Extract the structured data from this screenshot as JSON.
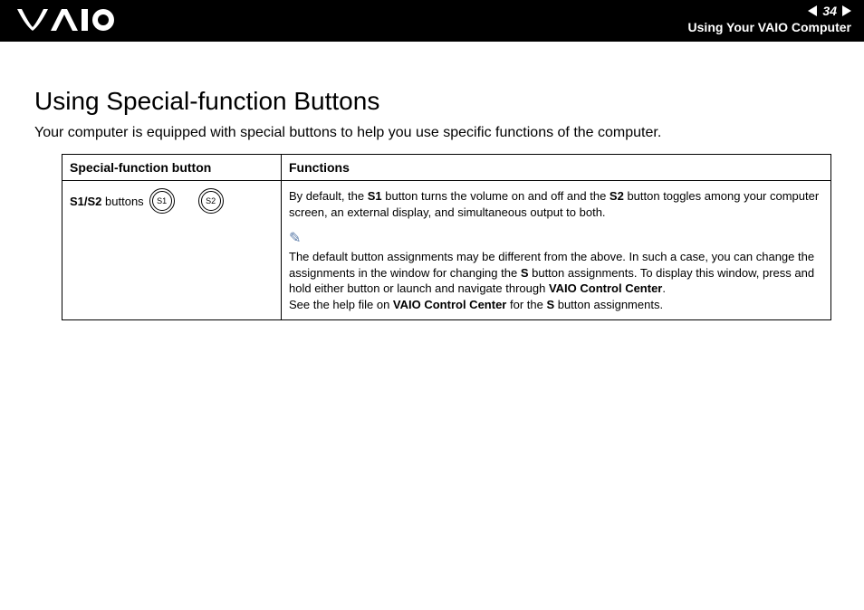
{
  "header": {
    "page_number": "34",
    "section": "Using Your VAIO Computer"
  },
  "title": "Using Special-function Buttons",
  "intro": "Your computer is equipped with special buttons to help you use specific functions of the computer.",
  "table": {
    "col1": "Special-function button",
    "col2": "Functions",
    "row": {
      "btn_bold": "S1/S2",
      "btn_rest": " buttons",
      "icon1": "S1",
      "icon2": "S2",
      "p1a": "By default, the ",
      "p1b": "S1",
      "p1c": " button turns the volume on and off and the ",
      "p1d": "S2",
      "p1e": " button toggles among your computer screen, an external display, and simultaneous output to both.",
      "n1a": "The default button assignments may be different from the above. In such a case, you can change the assignments in the window for changing the ",
      "n1b": "S",
      "n1c": " button assignments. To display this window, press and hold either button or launch and navigate through ",
      "n1d": "VAIO Control Center",
      "n1e": ".",
      "n2a": "See the help file on ",
      "n2b": "VAIO Control Center",
      "n2c": " for the ",
      "n2d": "S",
      "n2e": " button assignments."
    }
  }
}
